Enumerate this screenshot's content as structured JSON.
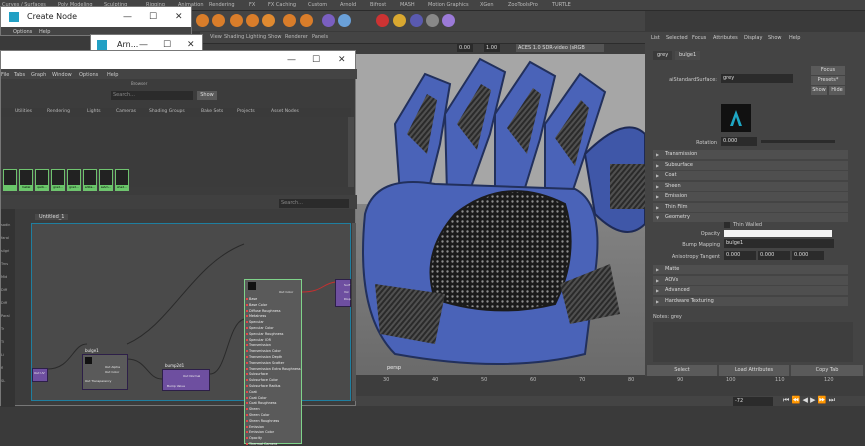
{
  "shelf": {
    "tabs": [
      "Curves / Surfaces",
      "Poly Modeling",
      "Sculpting",
      "Rigging",
      "Animation",
      "Rendering",
      "FX",
      "FX Caching",
      "Custom",
      "Arnold",
      "Bifrost",
      "MASH",
      "Motion Graphics",
      "XGen",
      "ZooToolsPro",
      "TURTLE"
    ]
  },
  "create_node": {
    "title": "Create Node",
    "menu": [
      "Options",
      "Help"
    ]
  },
  "hypershade": {
    "title": "Arn...",
    "menu": [
      "File",
      "Tabs",
      "Graph",
      "Window",
      "Options",
      "Help"
    ],
    "browser_title": "Browser",
    "search_placeholder": "Search...",
    "show_label": "Show",
    "browser_tabs": [
      "Utilities",
      "Rendering",
      "Lights",
      "Cameras",
      "Shading Groups",
      "Bake Sets",
      "Projects",
      "Asset Nodes"
    ],
    "swatches": [
      "",
      "metal",
      "qarb...",
      "grad...",
      "grad...",
      "aiSta...",
      "aiAm...",
      "shad..."
    ],
    "graph_search_placeholder": "Search...",
    "graph_tab": "Untitled_1",
    "left_list": [
      "sadin",
      "faral",
      "siigri",
      "Trns",
      "Mid",
      "Diff",
      "Diff",
      "Paral",
      "Tr",
      "Ti",
      "Li",
      "fl",
      "SL"
    ],
    "nodes": {
      "place2d": {
        "title": "",
        "ports": [
          "Out UV",
          "Out UVFilter"
        ]
      },
      "bulge": {
        "title": "bulge1",
        "ports": [
          "Out Alpha",
          "Out Color",
          "Out Transparency"
        ]
      },
      "bump": {
        "title": "bump2d1",
        "ports": [
          "Out Normal",
          "Bump Value"
        ]
      },
      "standard": {
        "title": "",
        "out": "Out Color",
        "attrs": [
          "Base",
          "Base Color",
          "Diffuse Roughness",
          "Metalness",
          "Specular",
          "Specular Color",
          "Specular Roughness",
          "Specular IOR",
          "Transmission",
          "Transmission Color",
          "Transmission Depth",
          "Transmission Scatter",
          "Transmission Extra Roughness",
          "Subsurface",
          "Subsurface Color",
          "Subsurface Radius",
          "Coat",
          "Coat Color",
          "Coat Roughness",
          "Sheen",
          "Sheen Color",
          "Sheen Roughness",
          "Emission",
          "Emission Color",
          "Opacity",
          "Thermal Camera"
        ]
      },
      "sg": {
        "ports": [
          "Surf",
          "Vol",
          "Disp"
        ]
      }
    }
  },
  "viewport": {
    "menu": [
      "View",
      "Shading",
      "Lighting",
      "Show",
      "Renderer",
      "Panels"
    ],
    "exposure": "0.00",
    "gamma": "1.00",
    "colorspace": "ACES 1.0 SDR-video (sRGB",
    "camera_label": "persp"
  },
  "attribute_editor": {
    "menu": [
      "List",
      "Selected",
      "Focus",
      "Attributes",
      "Display",
      "Show",
      "Help"
    ],
    "tabs": [
      "grey",
      "bulge1"
    ],
    "shader_type": "aiStandardSurface:",
    "shader_name": "grey",
    "focus_label": "Focus",
    "presets_label": "Presets*",
    "show_label": "Show",
    "hide_label": "Hide",
    "rotation_label": "Rotation",
    "rotation_value": "0.000",
    "sections_top": [
      "Transmission",
      "Subsurface",
      "Coat",
      "Sheen",
      "Emission",
      "Thin Film",
      "Geometry"
    ],
    "thin_walled_label": "Thin Walled",
    "opacity_label": "Opacity",
    "bump_label": "Bump Mapping",
    "bump_value": "bulge1",
    "aniso_label": "Anisotropy Tangent",
    "aniso_values": [
      "0.000",
      "0.000",
      "0.000"
    ],
    "sections_bottom": [
      "Matte",
      "AOVs",
      "Advanced",
      "Hardware Texturing"
    ],
    "notes": "Notes:  grey",
    "buttons": [
      "Select",
      "Load Attributes",
      "Copy Tab"
    ]
  },
  "timeline": {
    "ticks": [
      "30",
      "40",
      "50",
      "60",
      "70",
      "80",
      "90",
      "100",
      "110",
      "120"
    ],
    "current_frame": "-72"
  },
  "colors": {
    "glove_blue": "#4a63b8",
    "node_purple": "#6e4fa0",
    "swatch_green": "#6ac76a",
    "accent_teal": "#1e8fa8"
  }
}
